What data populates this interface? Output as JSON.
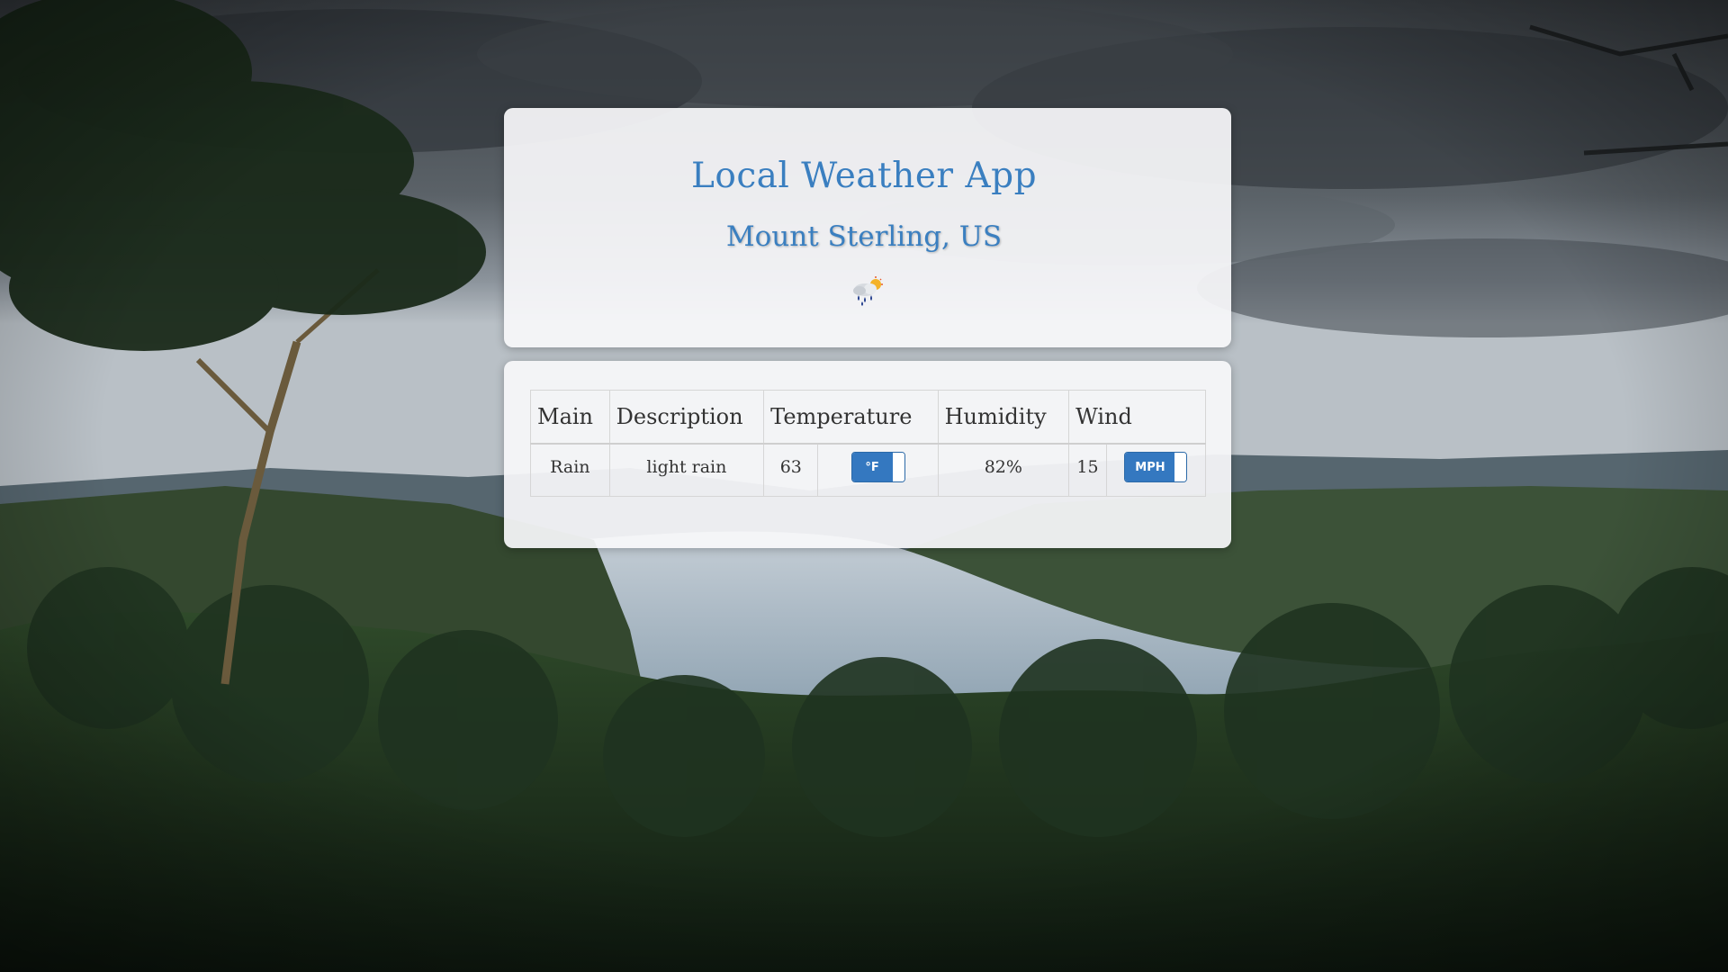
{
  "app": {
    "title": "Local Weather App",
    "location": "Mount Sterling, US",
    "weather_icon": "rain-with-sun-icon"
  },
  "table": {
    "headers": {
      "main": "Main",
      "description": "Description",
      "temperature": "Temperature",
      "humidity": "Humidity",
      "wind": "Wind"
    },
    "row": {
      "main": "Rain",
      "description": "light rain",
      "temperature": "63",
      "temperature_unit_toggle": "°F",
      "humidity": "82%",
      "wind": "15",
      "wind_unit_toggle": "MPH"
    }
  },
  "colors": {
    "accent": "#3a7fc0",
    "toggle_bg": "#3478c0",
    "panel_bg": "#f8f8fa"
  }
}
